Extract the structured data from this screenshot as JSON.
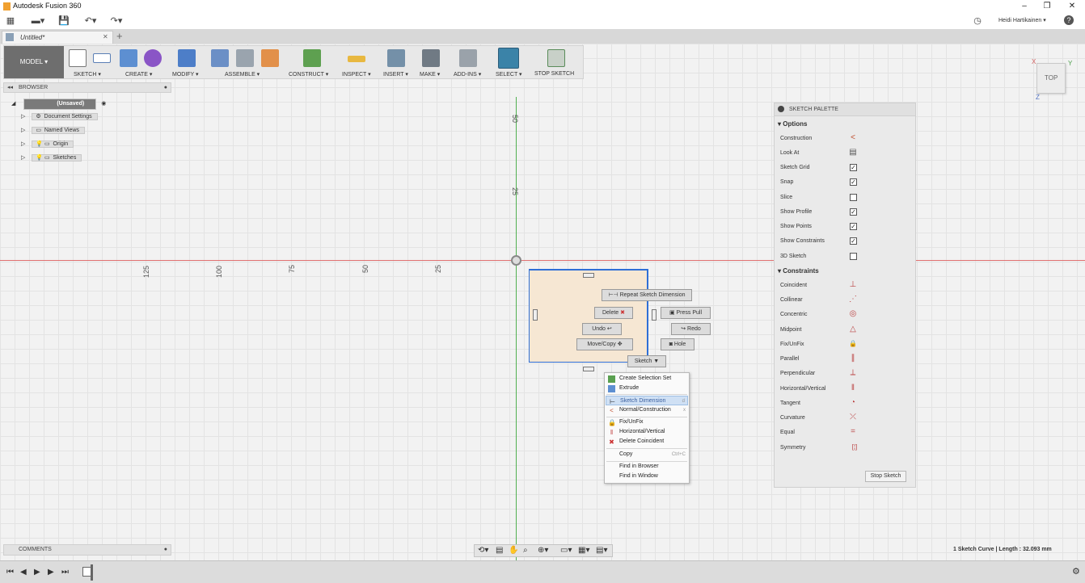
{
  "app": {
    "title": "Autodesk Fusion 360",
    "user": "Heidi Hartikainen",
    "help": "?"
  },
  "window_controls": {
    "minimize": "–",
    "restore": "❐",
    "close": "✕"
  },
  "tabs": [
    {
      "label": "Untitled*",
      "close": "✕"
    }
  ],
  "new_tab": "+",
  "ribbon": {
    "workspace": "MODEL ▾",
    "groups": [
      {
        "label": "SKETCH ▾"
      },
      {
        "label": "CREATE ▾"
      },
      {
        "label": "MODIFY ▾"
      },
      {
        "label": "ASSEMBLE ▾"
      },
      {
        "label": "CONSTRUCT ▾"
      },
      {
        "label": "INSPECT ▾"
      },
      {
        "label": "INSERT ▾"
      },
      {
        "label": "MAKE ▾"
      },
      {
        "label": "ADD-INS ▾"
      },
      {
        "label": "SELECT ▾"
      },
      {
        "label": "STOP SKETCH"
      }
    ]
  },
  "browser": {
    "title": "BROWSER",
    "root": "(Unsaved)",
    "items": [
      "Document Settings",
      "Named Views",
      "Origin",
      "Sketches"
    ]
  },
  "comments": {
    "title": "COMMENTS"
  },
  "viewcube": {
    "face": "TOP",
    "axes": {
      "x": "X",
      "y": "Y",
      "z": "Z"
    }
  },
  "rulers": {
    "vertical": [
      "50",
      "25"
    ],
    "horizontal": [
      "125",
      "100",
      "75",
      "50",
      "25"
    ]
  },
  "marking_menu": {
    "repeat": "Repeat Sketch Dimension",
    "delete": "Delete",
    "press_pull": "Press Pull",
    "undo": "Undo",
    "redo": "Redo",
    "move_copy": "Move/Copy",
    "hole": "Hole",
    "sketch": "Sketch"
  },
  "context_menu": [
    {
      "label": "Create Selection Set",
      "shortcut": ""
    },
    {
      "label": "Extrude",
      "shortcut": ""
    },
    {
      "label": "Sketch Dimension",
      "shortcut": "d",
      "highlight": true
    },
    {
      "label": "Normal/Construction",
      "shortcut": "x"
    },
    {
      "label": "Fix/UnFix",
      "shortcut": ""
    },
    {
      "label": "Horizontal/Vertical",
      "shortcut": ""
    },
    {
      "label": "Delete Coincident",
      "shortcut": ""
    },
    {
      "label": "Copy",
      "shortcut": "Ctrl+C"
    },
    {
      "label": "Find in Browser",
      "shortcut": ""
    },
    {
      "label": "Find in Window",
      "shortcut": ""
    }
  ],
  "palette": {
    "title": "SKETCH PALETTE",
    "options_title": "Options",
    "options": [
      {
        "label": "Construction",
        "control": "icon",
        "icon": "construction-icon"
      },
      {
        "label": "Look At",
        "control": "icon",
        "icon": "look-at-icon"
      },
      {
        "label": "Sketch Grid",
        "control": "checkbox",
        "checked": true
      },
      {
        "label": "Snap",
        "control": "checkbox",
        "checked": true
      },
      {
        "label": "Slice",
        "control": "checkbox",
        "checked": false
      },
      {
        "label": "Show Profile",
        "control": "checkbox",
        "checked": true
      },
      {
        "label": "Show Points",
        "control": "checkbox",
        "checked": true
      },
      {
        "label": "Show Constraints",
        "control": "checkbox",
        "checked": true
      },
      {
        "label": "3D Sketch",
        "control": "checkbox",
        "checked": false
      }
    ],
    "constraints_title": "Constraints",
    "constraints": [
      {
        "label": "Coincident",
        "glyph": "⊥"
      },
      {
        "label": "Collinear",
        "glyph": "⋰"
      },
      {
        "label": "Concentric",
        "glyph": "◎"
      },
      {
        "label": "Midpoint",
        "glyph": "△"
      },
      {
        "label": "Fix/UnFix",
        "glyph": "🔒"
      },
      {
        "label": "Parallel",
        "glyph": "∥"
      },
      {
        "label": "Perpendicular",
        "glyph": "⟂"
      },
      {
        "label": "Horizontal/Vertical",
        "glyph": "‖"
      },
      {
        "label": "Tangent",
        "glyph": "◔"
      },
      {
        "label": "Curvature",
        "glyph": "⤫"
      },
      {
        "label": "Equal",
        "glyph": "="
      },
      {
        "label": "Symmetry",
        "glyph": "[¦]"
      }
    ],
    "stop_button": "Stop Sketch"
  },
  "status": {
    "text": "1 Sketch Curve | Length : 32.093 mm"
  },
  "colors": {
    "x_axis": "#e07070",
    "y_axis": "#50b050",
    "sketch_line": "#2f6fd6",
    "profile_fill": "#f6e7d3"
  }
}
